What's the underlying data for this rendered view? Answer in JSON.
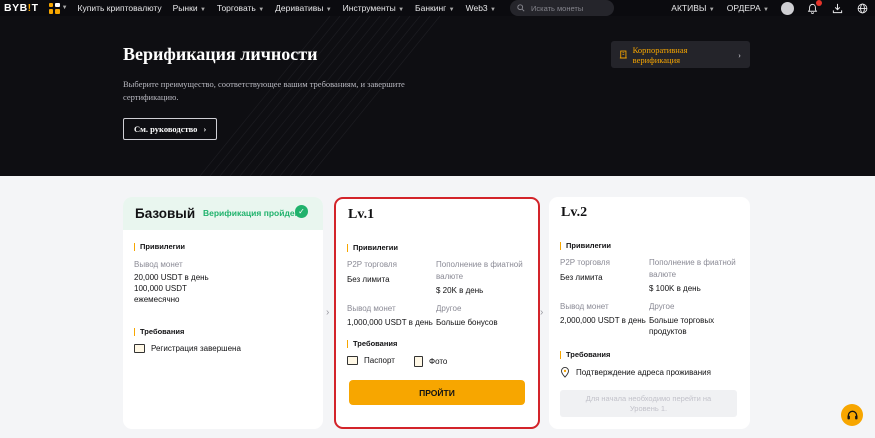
{
  "nav": {
    "logo_main": "BYB",
    "logo_accent": "!",
    "logo_end": "T",
    "menu": [
      "Купить криптовалюту",
      "Рынки",
      "Торговать",
      "Деривативы",
      "Инструменты",
      "Банкинг",
      "Web3"
    ],
    "search_placeholder": "Искать монеты",
    "assets": "АКТИВЫ",
    "orders": "ОРДЕРА"
  },
  "hero": {
    "title": "Верификация личности",
    "subtitle": "Выберите преимущество, соответствующее вашим требованиям, и завершите сертификацию.",
    "guide_button": "См. руководство",
    "corporate_button": "Корпоративная верификация"
  },
  "basic": {
    "title": "Базовый",
    "status": "Верификация пройдена",
    "privileges_label": "Привилегии",
    "withdraw_label": "Вывод монет",
    "withdraw_value_1": "20,000 USDT в день",
    "withdraw_value_2": "100,000 USDT",
    "withdraw_value_3": "ежемесячно",
    "requirements_label": "Требования",
    "req_1": "Регистрация завершена"
  },
  "lv1": {
    "title": "Lv.1",
    "privileges_label": "Привилегии",
    "p2p_label": "P2P торговля",
    "p2p_value": "Без лимита",
    "fiat_label_1": "Пополнение в фиатной",
    "fiat_label_2": "валюте",
    "fiat_value": "$ 20K в день",
    "withdraw_label": "Вывод монет",
    "withdraw_value": "1,000,000 USDT в день",
    "other_label": "Другое",
    "other_value": "Больше бонусов",
    "requirements_label": "Требования",
    "req_1": "Паспорт",
    "req_2": "Фото",
    "button": "ПРОЙТИ"
  },
  "lv2": {
    "title": "Lv.2",
    "privileges_label": "Привилегии",
    "p2p_label": "P2P торговля",
    "p2p_value": "Без лимита",
    "fiat_label_1": "Пополнение в фиатной",
    "fiat_label_2": "валюте",
    "fiat_value": "$ 100K в день",
    "withdraw_label": "Вывод монет",
    "withdraw_value": "2,000,000 USDT в день",
    "other_label": "Другое",
    "other_value_1": "Больше торговых",
    "other_value_2": "продуктов",
    "requirements_label": "Требования",
    "req_1": "Подтверждение адреса проживания",
    "disabled_1": "Для начала необходимо перейти на",
    "disabled_2": "Уровень 1."
  },
  "colors": {
    "accent": "#f7a600",
    "success": "#20b26c",
    "highlight": "#d3242a"
  }
}
